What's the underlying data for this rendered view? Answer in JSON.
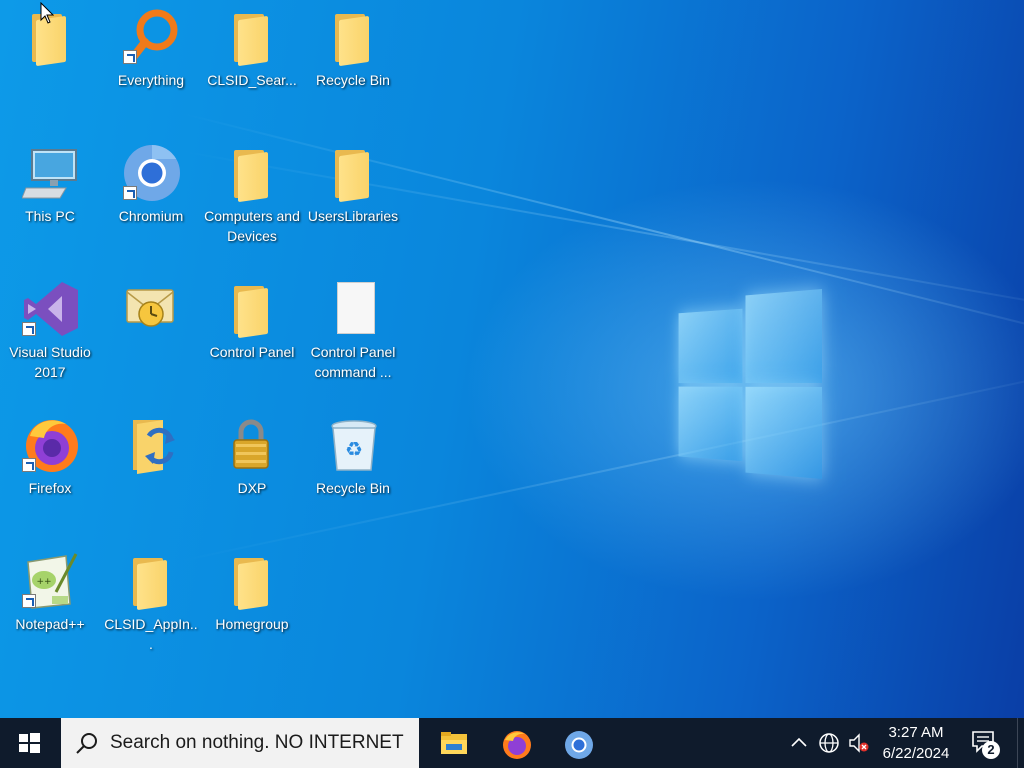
{
  "desktop": {
    "icons": [
      {
        "label": ""
      },
      {
        "label": "Everything"
      },
      {
        "label": "CLSID_Sear..."
      },
      {
        "label": "Recycle Bin"
      },
      {
        "label": "This PC"
      },
      {
        "label": "Chromium"
      },
      {
        "label": "Computers and Devices"
      },
      {
        "label": "UsersLibraries"
      },
      {
        "label": "Visual Studio 2017"
      },
      {
        "label": ""
      },
      {
        "label": "Control Panel"
      },
      {
        "label": "Control Panel command ..."
      },
      {
        "label": "Firefox"
      },
      {
        "label": ""
      },
      {
        "label": "DXP"
      },
      {
        "label": "Recycle Bin"
      },
      {
        "label": "Notepad++"
      },
      {
        "label": "CLSID_AppIn..."
      },
      {
        "label": "Homegroup"
      }
    ]
  },
  "taskbar": {
    "search_placeholder": "Search on nothing. NO INTERNET",
    "pinned_apps": [
      "File Explorer",
      "Firefox",
      "Chromium"
    ],
    "clock": {
      "time": "3:27 AM",
      "date": "6/22/2024"
    },
    "notification_count": "2"
  },
  "colors": {
    "taskbar_bg": "#0f1b2c",
    "desktop_accent": "#0a86dc",
    "folder_yellow": "#f9d36a"
  }
}
